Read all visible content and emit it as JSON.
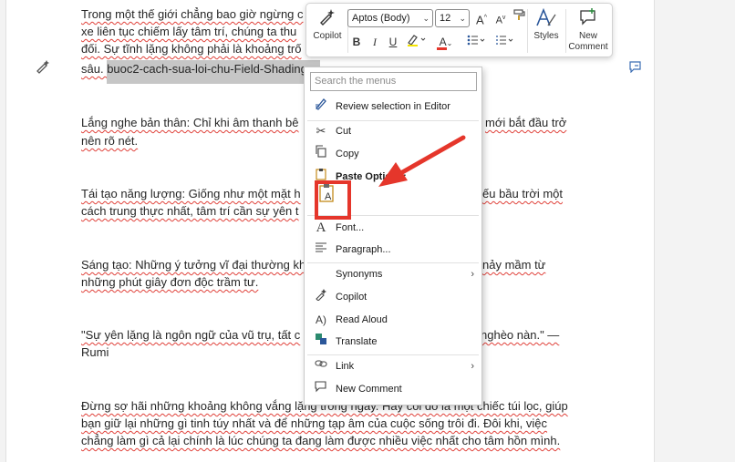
{
  "document": {
    "p1": {
      "line1": "Trong một thế giới chẳng bao giờ ngừng c",
      "line2": "xe liên tục chiếm lấy tâm trí, chúng ta thu",
      "line3": "đối. Sự tĩnh lặng không phải là khoảng trố",
      "line4_pre": "sâu. ",
      "selected": "buoc2-cach-sua-loi-chu-Field-Shading"
    },
    "p2": {
      "line1_a": "Lắng nghe bản thân: Chỉ khi âm thanh bê",
      "line1_b": "mới bắt đầu trở",
      "line2": "nên rõ nét."
    },
    "p3": {
      "line1_a": "Tái tạo năng lượng: Giống như một mặt h",
      "line1_b": "ếu bầu trời một",
      "line2": "cách trung thực nhất, tâm trí cần sự yên t"
    },
    "p4": {
      "line1_a": "Sáng tạo: Những ý tưởng vĩ đại thường kh",
      "line1_b": "nảy mầm từ",
      "line2": "những phút giây đơn độc trầm tư."
    },
    "p5": {
      "line1_a": "\"Sự yên lặng là ngôn ngữ của vũ trụ, tất c",
      "line1_b": "nghèo nàn.\" —",
      "line2": "Rumi"
    },
    "p6": {
      "line1": "Đừng sợ hãi những khoảng không vắng lặng trong ngày. Hãy coi đó là một chiếc túi lọc, giúp",
      "line2": "bạn giữ lại những gì tinh túy nhất và để những tạp âm của cuộc sống trôi đi. Đôi khi, việc",
      "line3": "chẳng làm gì cả lại chính là lúc chúng ta đang làm được nhiều việc nhất cho tâm hồn mình."
    }
  },
  "mini_toolbar": {
    "copilot_label": "Copilot",
    "font_name": "Aptos (Body)",
    "font_size": "12",
    "grow_font": "A",
    "shrink_font": "A",
    "bold": "B",
    "italic": "I",
    "underline": "U",
    "font_color": "A",
    "styles_label": "Styles",
    "new_comment_label_1": "New",
    "new_comment_label_2": "Comment"
  },
  "context_menu": {
    "search_placeholder": "Search the menus",
    "review_selection": "Review selection in Editor",
    "cut": "Cut",
    "copy": "Copy",
    "paste_options": "Paste Options:",
    "paste_keep_text_glyph": "A",
    "font": "Font...",
    "paragraph": "Paragraph...",
    "synonyms": "Synonyms",
    "copilot": "Copilot",
    "read_aloud": "Read Aloud",
    "translate": "Translate",
    "link": "Link",
    "new_comment": "New Comment"
  },
  "colors": {
    "annotation_red": "#e5362b",
    "selection_gray": "#c6c6c6",
    "accent_blue": "#2b579a"
  }
}
